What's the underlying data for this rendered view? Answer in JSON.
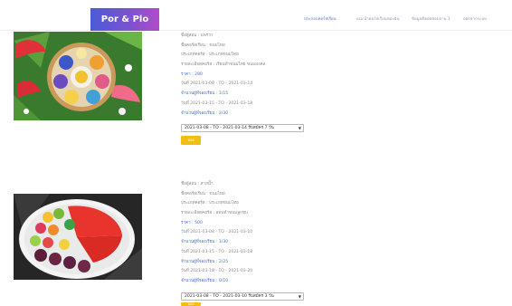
{
  "brand": {
    "name": "Por & Plo"
  },
  "nav": {
    "items": [
      "ประกอบคอร์สเรียน",
      "แนะนำคอร์สเรียนของฉัน",
      "ข้อมูลติดต่อสอบถาม 1",
      "ออกจากระบบ"
    ]
  },
  "colors": {
    "brand_gradient": [
      "#4a5bd8",
      "#b14cc8"
    ],
    "accent_blue": "#4a6fd0",
    "button_yellow": "#f2be12"
  },
  "courses": [
    {
      "image": "tray-of-thai-desserts",
      "lines": [
        {
          "text": "ชื่อผู้สอน : แพรวา",
          "style": "plain"
        },
        {
          "text": "ชื่อคอร์สเรียน : ขนมไทย",
          "style": "plain"
        },
        {
          "text": "ประเภทคอร์ส : ประเภทขนมไทย",
          "style": "plain"
        },
        {
          "text": "รายละเอียดคอร์ส : เรียนทำขนมไทย ขนมมงคล",
          "style": "plain"
        },
        {
          "text": "ราคา : 280",
          "style": "price"
        },
        {
          "text": "วันที่ 2021-03-08 - TO - 2021-03-14",
          "style": "plain"
        },
        {
          "text": "จำนวนผู้ที่จองเรียน : 1/15",
          "style": "hl"
        },
        {
          "text": "วันที่ 2021-03-15 - TO - 2021-03-18",
          "style": "plain"
        },
        {
          "text": "จำนวนผู้ที่จองเรียน : 2/30",
          "style": "hl"
        }
      ],
      "select_value": "2021-03-08 - TO - 2021-03-14 รับสมัคร 7 วัน",
      "book_label": "จอง"
    },
    {
      "image": "plate-of-fruit-shaped-desserts",
      "lines": [
        {
          "text": "ชื่อผู้สอน : สายน้ำ",
          "style": "plain"
        },
        {
          "text": "ชื่อคอร์สเรียน : ขนมไทย",
          "style": "plain"
        },
        {
          "text": "ประเภทคอร์ส : ประเภทขนมไทย",
          "style": "plain"
        },
        {
          "text": "รายละเอียดคอร์ส : สอนทำขนมลูกชุบ",
          "style": "plain"
        },
        {
          "text": "ราคา : 500",
          "style": "price"
        },
        {
          "text": "วันที่ 2021-03-08 - TO - 2021-03-10",
          "style": "plain"
        },
        {
          "text": "จำนวนผู้ที่จองเรียน : 1/30",
          "style": "hl"
        },
        {
          "text": "วันที่ 2021-03-15 - TO - 2021-03-18",
          "style": "plain"
        },
        {
          "text": "จำนวนผู้ที่จองเรียน : 2/25",
          "style": "hl"
        },
        {
          "text": "วันที่ 2021-03-18 - TO - 2021-03-20",
          "style": "plain"
        },
        {
          "text": "จำนวนผู้ที่จองเรียน : 0/10",
          "style": "hl"
        }
      ],
      "select_value": "2021-03-08 - TO - 2021-03-10 รับสมัคร 3 วัน",
      "book_label": "จอง"
    }
  ]
}
